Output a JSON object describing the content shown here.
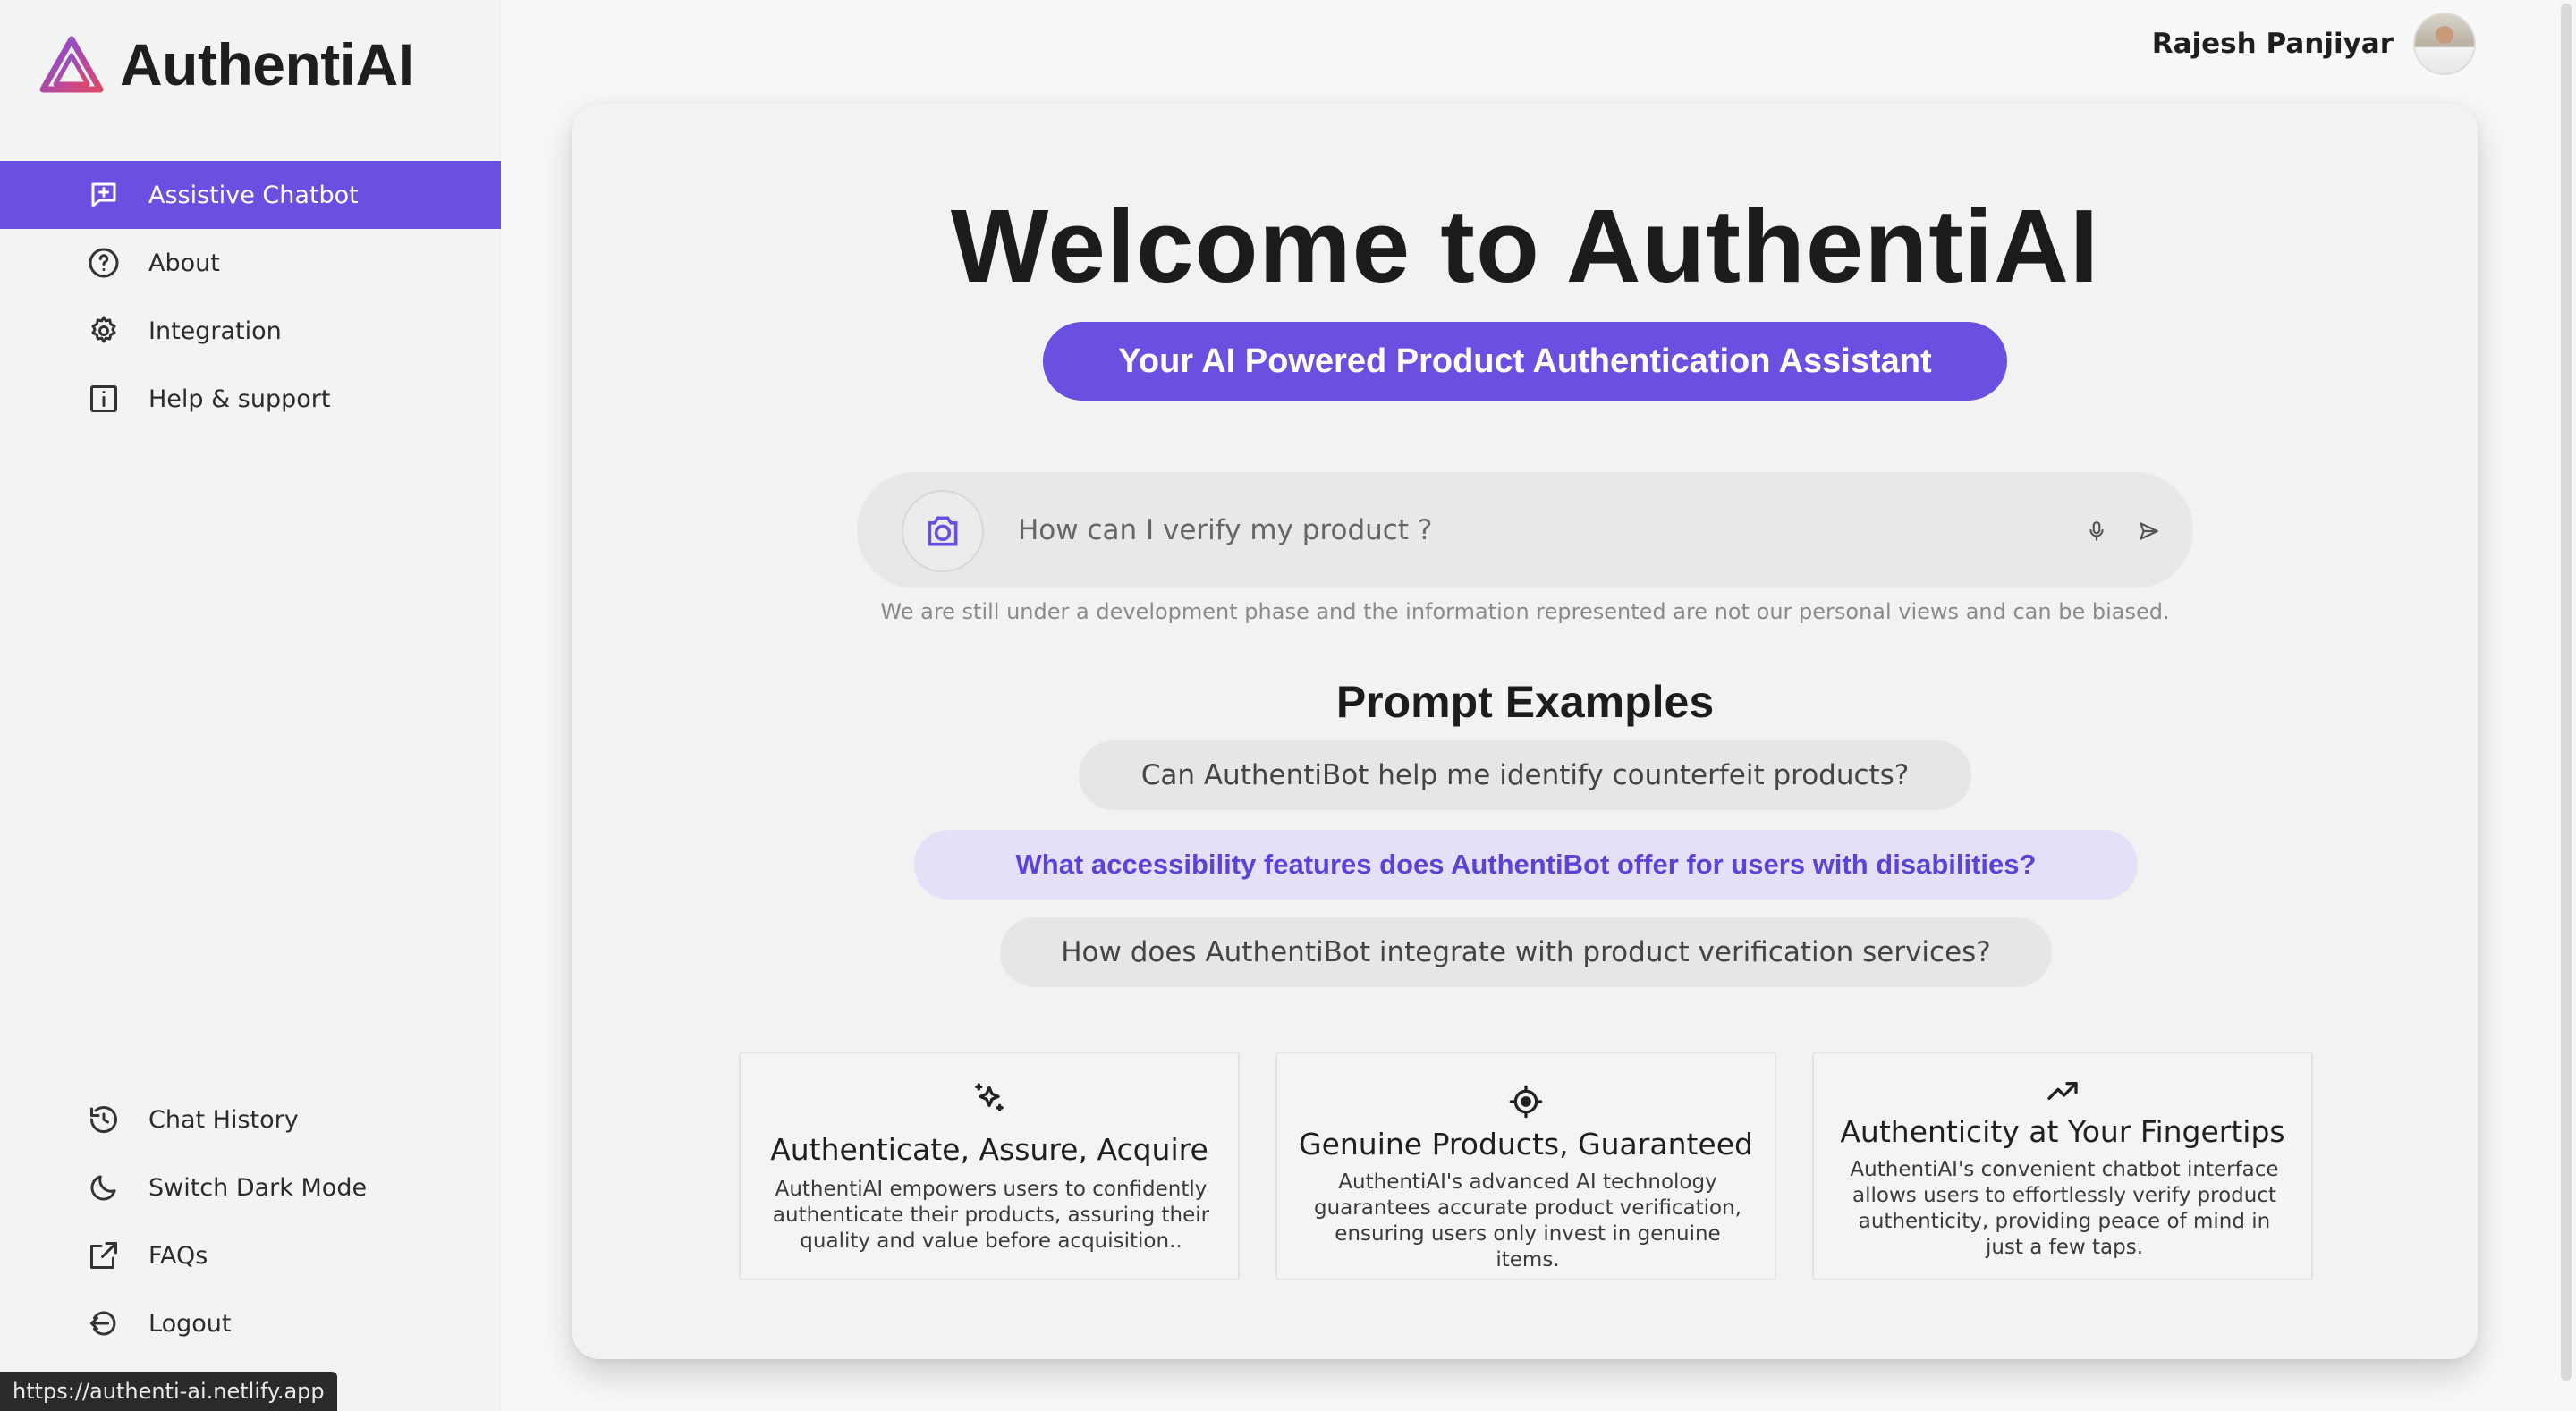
{
  "app": {
    "name": "AuthentiAI",
    "brand_color": "#6b4fe0"
  },
  "sidebar": {
    "top_items": [
      {
        "label": "Assistive Chatbot",
        "icon": "chat-plus-icon",
        "active": true
      },
      {
        "label": "About",
        "icon": "help-circle-icon",
        "active": false
      },
      {
        "label": "Integration",
        "icon": "gear-icon",
        "active": false
      },
      {
        "label": "Help & support",
        "icon": "info-square-icon",
        "active": false
      }
    ],
    "bottom_items": [
      {
        "label": "Chat History",
        "icon": "history-icon"
      },
      {
        "label": "Switch Dark Mode",
        "icon": "moon-icon"
      },
      {
        "label": "FAQs",
        "icon": "external-link-icon"
      },
      {
        "label": "Logout",
        "icon": "logout-icon"
      }
    ]
  },
  "header": {
    "user_name": "Rajesh Panjiyar"
  },
  "main": {
    "welcome": "Welcome to AuthentiAI",
    "subtitle": "Your AI Powered Product Authentication Assistant",
    "search": {
      "placeholder": "How can I verify my product ?"
    },
    "disclaimer": "We are still under a development phase and the information represented are not our personal views and can be biased.",
    "prompt_title": "Prompt Examples",
    "prompts": [
      "Can AuthentiBot help me identify counterfeit products?",
      "What accessibility features does AuthentiBot offer for users with disabilities?",
      "How does AuthentiBot integrate with product verification services?"
    ],
    "features": [
      {
        "icon": "sparkles-icon",
        "title": "Authenticate, Assure, Acquire",
        "description": "AuthentiAI empowers users to confidently authenticate their products, assuring their quality and value before acquisition.."
      },
      {
        "icon": "target-icon",
        "title": "Genuine Products, Guaranteed",
        "description": "AuthentiAI's advanced AI technology guarantees accurate product verification, ensuring users only invest in genuine items."
      },
      {
        "icon": "trending-up-icon",
        "title": "Authenticity at Your Fingertips",
        "description": "AuthentiAI's convenient chatbot interface allows users to effortlessly verify product authenticity, providing peace of mind in just a few taps."
      }
    ]
  },
  "status_bar": {
    "url": "https://authenti-ai.netlify.app"
  }
}
